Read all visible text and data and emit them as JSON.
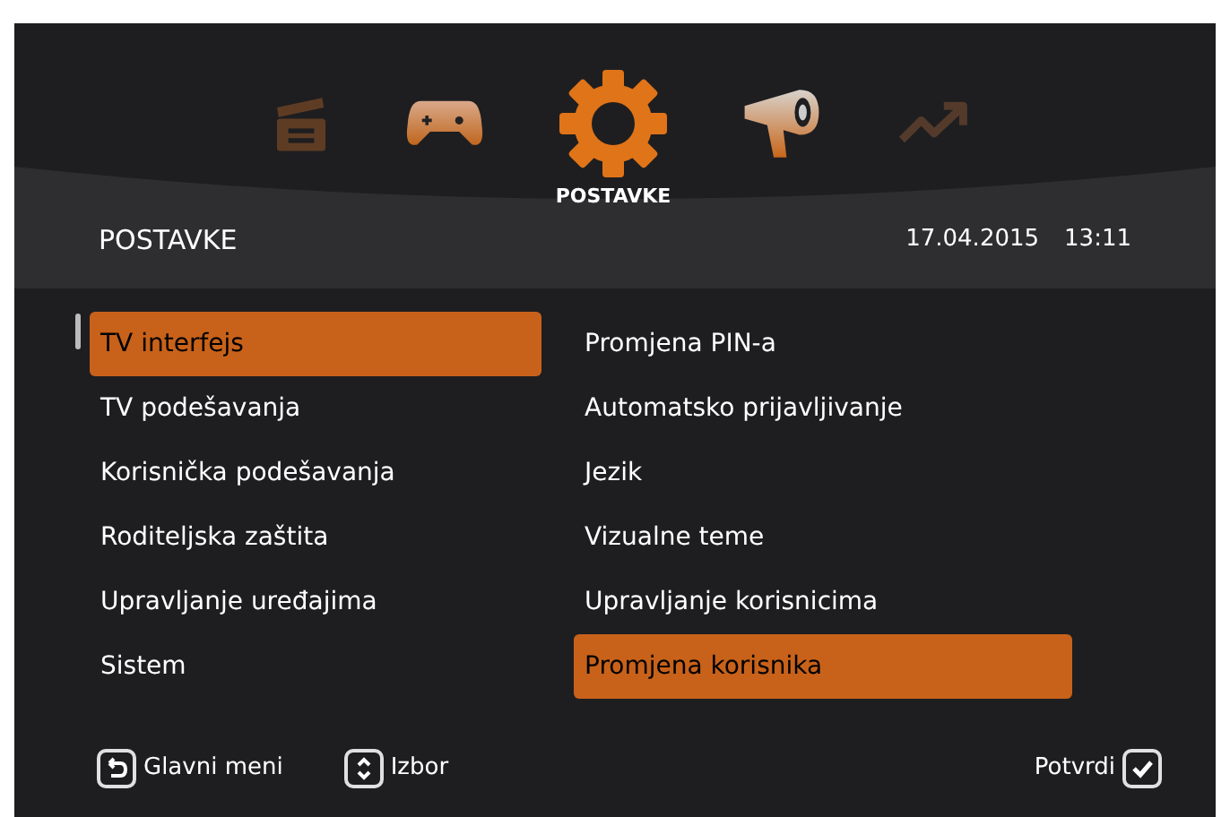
{
  "nav": [
    {
      "kind": "clapper",
      "selected": false
    },
    {
      "kind": "gamepad",
      "selected": false
    },
    {
      "kind": "gear",
      "selected": true,
      "label": "POSTAVKE"
    },
    {
      "kind": "megaphone",
      "selected": false
    },
    {
      "kind": "trend",
      "selected": false
    }
  ],
  "header": {
    "title": "POSTAVKE",
    "date": "17.04.2015",
    "time": "13:11"
  },
  "left_menu": [
    {
      "label": "TV interfejs",
      "selected": true
    },
    {
      "label": "TV podešavanja",
      "selected": false
    },
    {
      "label": "Korisnička podešavanja",
      "selected": false
    },
    {
      "label": "Roditeljska zaštita",
      "selected": false
    },
    {
      "label": "Upravljanje uređajima",
      "selected": false
    },
    {
      "label": "Sistem",
      "selected": false
    }
  ],
  "right_menu": [
    {
      "label": "Promjena PIN-a",
      "selected": false
    },
    {
      "label": "Automatsko prijavljivanje",
      "selected": false
    },
    {
      "label": "Jezik",
      "selected": false
    },
    {
      "label": "Vizualne teme",
      "selected": false
    },
    {
      "label": "Upravljanje korisnicima",
      "selected": false
    },
    {
      "label": "Promjena korisnika",
      "selected": true
    }
  ],
  "footer": [
    {
      "kind": "back",
      "label": "Glavni meni"
    },
    {
      "kind": "updown",
      "label": "Izbor"
    },
    {
      "kind": "ok",
      "label": "Potvrdi"
    }
  ]
}
